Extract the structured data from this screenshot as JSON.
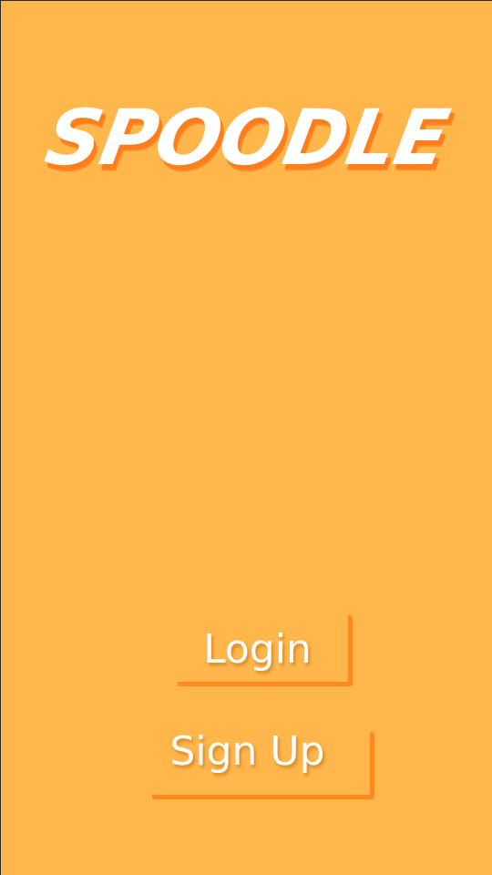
{
  "app": {
    "logo_text": "SPOODLE"
  },
  "actions": {
    "login_label": "Login",
    "signup_label": "Sign Up"
  },
  "colors": {
    "background": "#ffb64a",
    "accent": "#ff8a1f",
    "text": "#ffffff"
  }
}
